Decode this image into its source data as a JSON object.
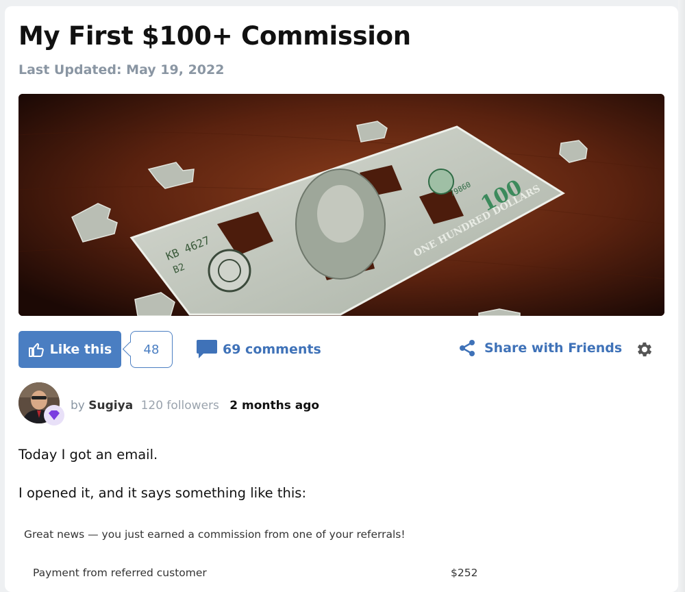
{
  "article": {
    "title": "My First $100+ Commission",
    "last_updated": "Last Updated: May 19, 2022"
  },
  "hero_image": {
    "description_icon": "money-puzzle-image",
    "bill_serial": "KB 4627",
    "bill_code": "B2",
    "bill_denomination": "100",
    "bill_text": "ONE HUNDRED DOLLARS",
    "bill_number": "79860"
  },
  "actions": {
    "like_label": "Like this",
    "like_count": "48",
    "comments_label": "69 comments",
    "share_label": "Share with Friends"
  },
  "author": {
    "by": "by",
    "name": "Sugiya",
    "followers": "120 followers",
    "posted": "2 months ago"
  },
  "body": {
    "p1": "Today I got an email.",
    "p2": "I opened it, and it says something like this:"
  },
  "email_snippet": {
    "headline": "Great news — you just earned a commission from one of your referrals!",
    "payment_label": "Payment from referred customer",
    "payment_amount": "$252"
  },
  "colors": {
    "accent": "#4a7ec2",
    "link": "#3f72b8",
    "muted": "#8a96a3"
  }
}
